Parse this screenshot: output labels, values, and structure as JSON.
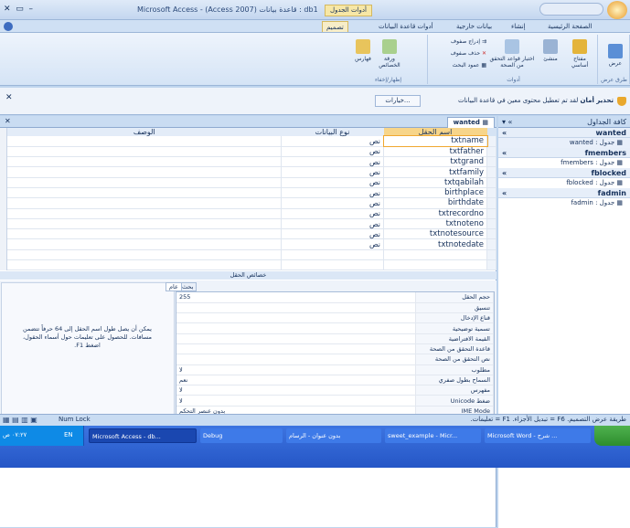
{
  "window": {
    "title": "Microsoft Access - (Access 2007) قاعدة بيانات : db1",
    "context_tool": "أدوات الجدول",
    "tray_time": "٠٧:٢٧ ص"
  },
  "ribbon": {
    "tabs": [
      "الصفحة الرئيسية",
      "إنشاء",
      "بيانات خارجية",
      "أدوات قاعدة البيانات",
      "تصميم"
    ],
    "groups": {
      "views": {
        "label": "طرق عرض",
        "button": "عرض"
      },
      "tools": {
        "label": "أدوات",
        "primary_key": "مفتاح أساسي",
        "builder": "منشئ",
        "test_rules": "اختبار قواعد التحقق من الصحة",
        "insert_rows": "إدراج صفوف",
        "delete_rows": "حذف صفوف",
        "lookup_column": "عمود البحث"
      },
      "showhide": {
        "label": "إظهار/إخفاء",
        "property_sheet": "ورقة الخصائص",
        "indexes": "فهارس"
      }
    }
  },
  "message": {
    "title": "تحذير أمان",
    "text": "لقد تم تعطيل محتوى معين في قاعدة البيانات",
    "button": "خيارات..."
  },
  "document": {
    "tab": "wanted",
    "columns": {
      "field_name": "اسم الحقل",
      "data_type": "نوع البيانات",
      "description": "الوصف"
    },
    "rows": [
      {
        "name": "txtname",
        "type": "نص"
      },
      {
        "name": "txtfather",
        "type": "نص"
      },
      {
        "name": "txtgrand",
        "type": "نص"
      },
      {
        "name": "txtfamily",
        "type": "نص"
      },
      {
        "name": "txtqabilah",
        "type": "نص"
      },
      {
        "name": "birthplace",
        "type": "نص"
      },
      {
        "name": "birthdate",
        "type": "نص"
      },
      {
        "name": "txtrecordno",
        "type": "نص"
      },
      {
        "name": "txtnoteno",
        "type": "نص"
      },
      {
        "name": "txtnotesource",
        "type": "نص"
      },
      {
        "name": "txtnotedate",
        "type": "نص"
      }
    ],
    "properties_header": "خصائص الحقل",
    "prop_tabs": {
      "general": "عام",
      "lookup": "بحث"
    },
    "properties": [
      {
        "label": "حجم الحقل",
        "value": "255"
      },
      {
        "label": "تنسيق",
        "value": ""
      },
      {
        "label": "قناع الإدخال",
        "value": ""
      },
      {
        "label": "تسمية توضيحية",
        "value": ""
      },
      {
        "label": "القيمة الافتراضية",
        "value": ""
      },
      {
        "label": "قاعدة التحقق من الصحة",
        "value": ""
      },
      {
        "label": "نص التحقق من الصحة",
        "value": ""
      },
      {
        "label": "مطلوب",
        "value": "لا"
      },
      {
        "label": "السماح بطول صفري",
        "value": "نعم"
      },
      {
        "label": "مفهرس",
        "value": "لا"
      },
      {
        "label": "ضغط Unicode",
        "value": "لا"
      },
      {
        "label": "IME Mode",
        "value": "بدون عنصر التحكم"
      },
      {
        "label": "IME Sentence Mode",
        "value": "بلا"
      },
      {
        "label": "علامات ذكية",
        "value": ""
      }
    ],
    "help_text": "يمكن أن يصل طول اسم الحقل إلى 64 حرفاً تتضمن مسافات. للحصول على تعليمات حول أسماء الحقول، اضغط F1."
  },
  "nav": {
    "header": "كافة الجداول",
    "groups": [
      {
        "name": "wanted",
        "item": "wanted : جدول"
      },
      {
        "name": "fmembers",
        "item": "fmembers : جدول"
      },
      {
        "name": "fblocked",
        "item": "fblocked : جدول"
      },
      {
        "name": "fadmin",
        "item": "fadmin : جدول"
      }
    ]
  },
  "status": {
    "text": "طريقة عرض التصميم. F6 = تبديل الأجزاء. F1 = تعليمات.",
    "numlock": "Num Lock"
  },
  "taskbar": {
    "items": [
      "Microsoft Word - شرح ...",
      "sweet_example - Micr...",
      "بدون عنوان - الرسام",
      "Debug",
      "Microsoft Access - db..."
    ],
    "lang": "EN"
  }
}
